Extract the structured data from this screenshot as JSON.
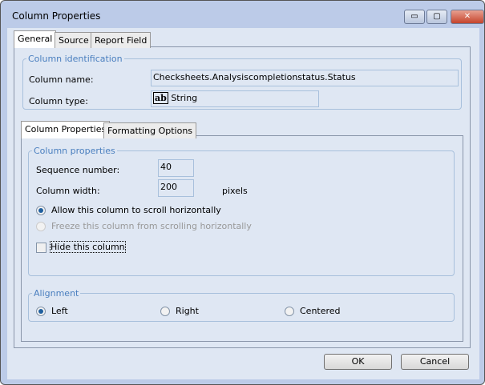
{
  "window": {
    "title": "Column Properties",
    "minimize": "▭",
    "maximize": "▢",
    "close": "✕"
  },
  "tabs": [
    "General",
    "Source",
    "Report Field"
  ],
  "identification": {
    "legend": "Column identification",
    "name_label": "Column name:",
    "name_value": "Checksheets.Analysiscompletionstatus.Status",
    "type_label": "Column type:",
    "type_icon": "ab",
    "type_value": "String"
  },
  "subtabs": [
    "Column Properties",
    "Formatting Options"
  ],
  "props": {
    "legend": "Column properties",
    "seq_label": "Sequence number:",
    "seq_value": "40",
    "width_label": "Column width:",
    "width_value": "200",
    "width_unit": "pixels",
    "scroll_label": "Allow this column to scroll horizontally",
    "freeze_label": "Freeze this column from scrolling horizontally",
    "hide_label": "Hide this column"
  },
  "alignment": {
    "legend": "Alignment",
    "left": "Left",
    "right": "Right",
    "centered": "Centered"
  },
  "buttons": {
    "ok": "OK",
    "cancel": "Cancel"
  }
}
